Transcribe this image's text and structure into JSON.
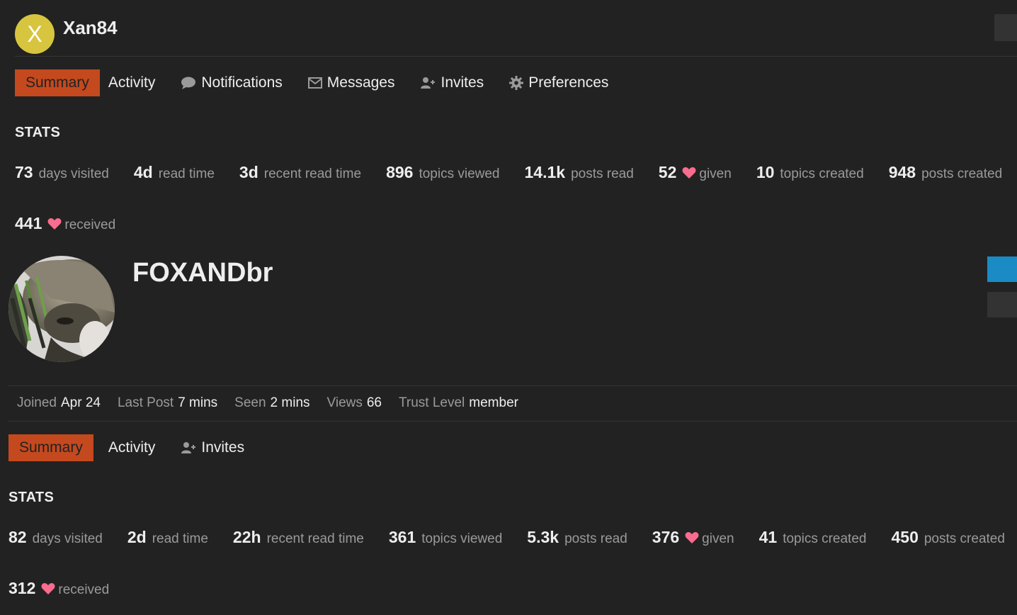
{
  "header": {
    "avatar_letter": "X",
    "username": "Xan84"
  },
  "user_nav": {
    "summary": "Summary",
    "activity": "Activity",
    "notifications": "Notifications",
    "messages": "Messages",
    "invites": "Invites",
    "preferences": "Preferences"
  },
  "user_stats": {
    "title": "STATS",
    "days_visited": {
      "value": "73",
      "label": "days visited"
    },
    "read_time": {
      "value": "4d",
      "label": "read time"
    },
    "recent_read_time": {
      "value": "3d",
      "label": "recent read time"
    },
    "topics_viewed": {
      "value": "896",
      "label": "topics viewed"
    },
    "posts_read": {
      "value": "14.1k",
      "label": "posts read"
    },
    "likes_given": {
      "value": "52",
      "label": "given"
    },
    "topics_created": {
      "value": "10",
      "label": "topics created"
    },
    "posts_created": {
      "value": "948",
      "label": "posts created"
    },
    "likes_received": {
      "value": "441",
      "label": "received"
    }
  },
  "profile": {
    "name": "FOXANDbr",
    "meta": {
      "joined_label": "Joined",
      "joined_value": "Apr 24",
      "last_post_label": "Last Post",
      "last_post_value": "7 mins",
      "seen_label": "Seen",
      "seen_value": "2 mins",
      "views_label": "Views",
      "views_value": "66",
      "trust_label": "Trust Level",
      "trust_value": "member"
    }
  },
  "profile_nav": {
    "summary": "Summary",
    "activity": "Activity",
    "invites": "Invites"
  },
  "profile_stats": {
    "title": "STATS",
    "days_visited": {
      "value": "82",
      "label": "days visited"
    },
    "read_time": {
      "value": "2d",
      "label": "read time"
    },
    "recent_read_time": {
      "value": "22h",
      "label": "recent read time"
    },
    "topics_viewed": {
      "value": "361",
      "label": "topics viewed"
    },
    "posts_read": {
      "value": "5.3k",
      "label": "posts read"
    },
    "likes_given": {
      "value": "376",
      "label": "given"
    },
    "topics_created": {
      "value": "41",
      "label": "topics created"
    },
    "posts_created": {
      "value": "450",
      "label": "posts created"
    },
    "likes_received": {
      "value": "312",
      "label": "received"
    }
  },
  "colors": {
    "background": "#222222",
    "accent": "#c4491e",
    "heart": "#fa6c8d",
    "message_button": "#1a8bc5",
    "avatar": "#d8c53f"
  },
  "icons": [
    "chat-bubble-icon",
    "envelope-icon",
    "user-plus-icon",
    "gear-icon",
    "heart-icon"
  ]
}
